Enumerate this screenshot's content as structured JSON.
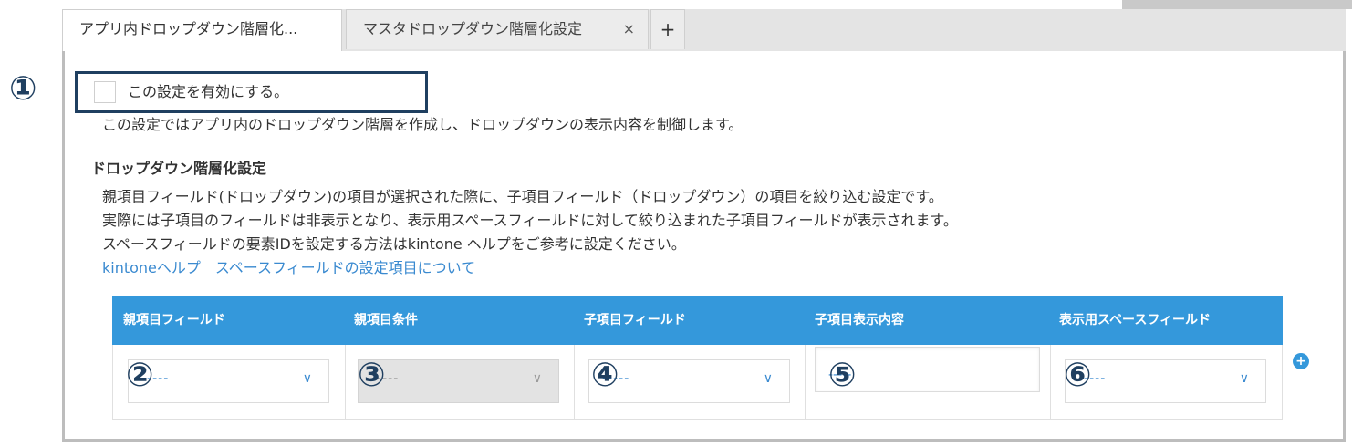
{
  "tabs": [
    {
      "label": "アプリ内ドロップダウン階層化..."
    },
    {
      "label": "マスタドロップダウン階層化設定",
      "close": "×"
    }
  ],
  "add_tab": "+",
  "callouts": [
    "①",
    "②",
    "③",
    "④",
    "⑤",
    "⑥"
  ],
  "enable": {
    "label": "この設定を有効にする。",
    "checked": false
  },
  "description": "この設定ではアプリ内のドロップダウン階層を作成し、ドロップダウンの表示内容を制御します。",
  "section": {
    "title": "ドロップダウン階層化設定",
    "lines": [
      "親項目フィールド(ドロップダウン)の項目が選択された際に、子項目フィールド（ドロップダウン）の項目を絞り込む設定です。",
      "実際には子項目のフィールドは非表示となり、表示用スペースフィールドに対して絞り込まれた子項目フィールドが表示されます。",
      "スペースフィールドの要素IDを設定する方法はkintone ヘルプをご参考に設定ください。"
    ],
    "link": "kintoneヘルプ　スペースフィールドの設定項目について"
  },
  "table": {
    "headers": [
      "親項目フィールド",
      "親項目条件",
      "子項目フィールド",
      "子項目表示内容",
      "表示用スペースフィールド"
    ],
    "row": {
      "parent_field": "-----",
      "parent_condition": "-----",
      "child_field": "-----",
      "child_display": "-----",
      "space_field": "-----"
    },
    "add_row": "+"
  },
  "colors": {
    "accent": "#3498db",
    "callout": "#1f3f60",
    "link": "#3a8ad0"
  }
}
